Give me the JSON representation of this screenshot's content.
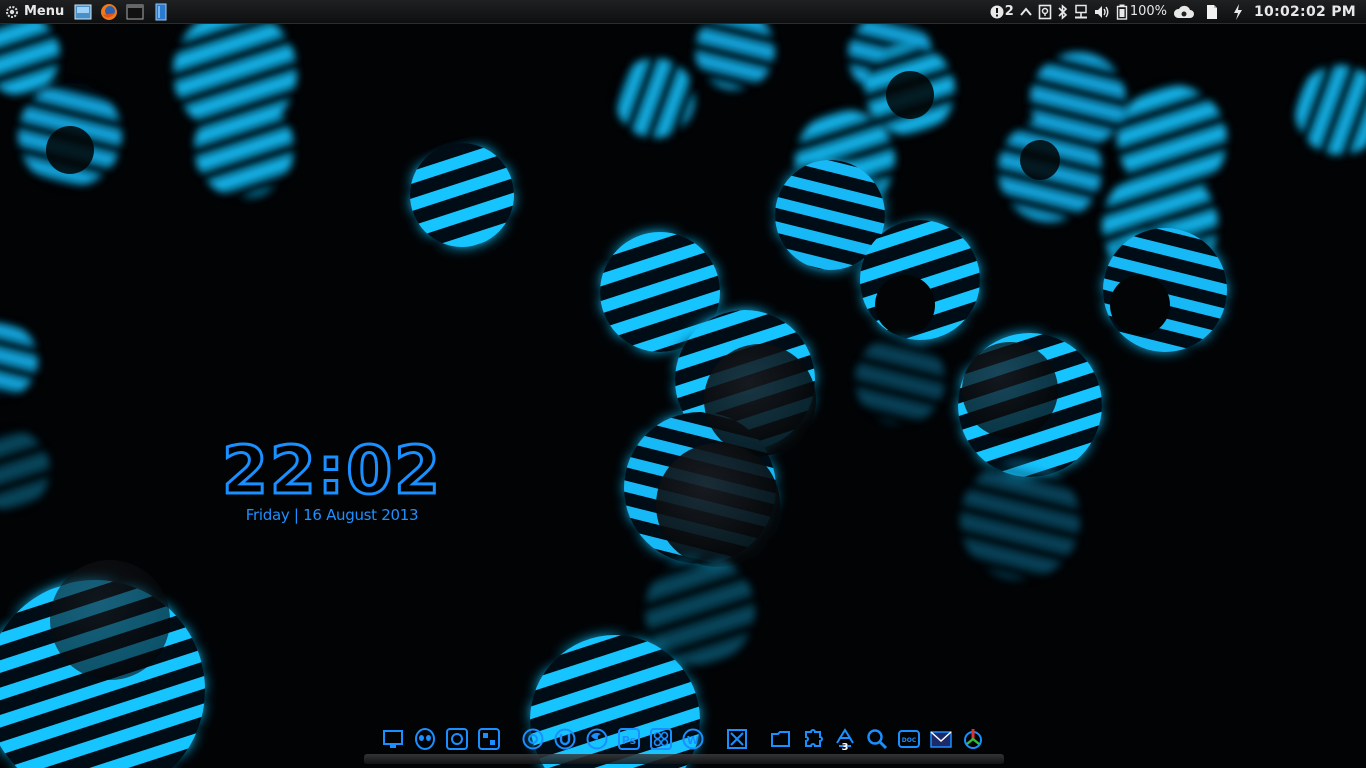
{
  "panel": {
    "menu_label": "Menu",
    "launchers": [
      "desktop-icon",
      "firefox-icon",
      "terminal-icon",
      "files-icon"
    ],
    "notifications_count": "2",
    "battery_label": "100%",
    "clock": "10:02:02 PM"
  },
  "desktop_clock": {
    "time": "22:02",
    "date": "Friday | 16 August 2013",
    "color": "#1a8fff"
  },
  "dock": {
    "items": [
      {
        "name": "monitor-icon"
      },
      {
        "name": "alien-face-icon"
      },
      {
        "name": "gimp-icon"
      },
      {
        "name": "control-panel-icon"
      },
      {
        "name": "chrome-icon"
      },
      {
        "name": "utorrent-icon"
      },
      {
        "name": "firefox-icon"
      },
      {
        "name": "photoshop-icon",
        "label": "Ps"
      },
      {
        "name": "settings-grid-icon"
      },
      {
        "name": "word-icon",
        "label": "W"
      },
      {
        "name": "close-box-icon"
      },
      {
        "name": "folder-icon"
      },
      {
        "name": "puzzle-icon"
      },
      {
        "name": "recycle-bin-icon",
        "badge": "3"
      },
      {
        "name": "magnifier-icon"
      },
      {
        "name": "document-icon",
        "label": "DOC"
      },
      {
        "name": "mail-icon"
      },
      {
        "name": "recycle-arrows-icon"
      }
    ],
    "accent": "#1a8fff"
  },
  "theme": {
    "glow": "#14b8ff",
    "background": "#010305"
  }
}
